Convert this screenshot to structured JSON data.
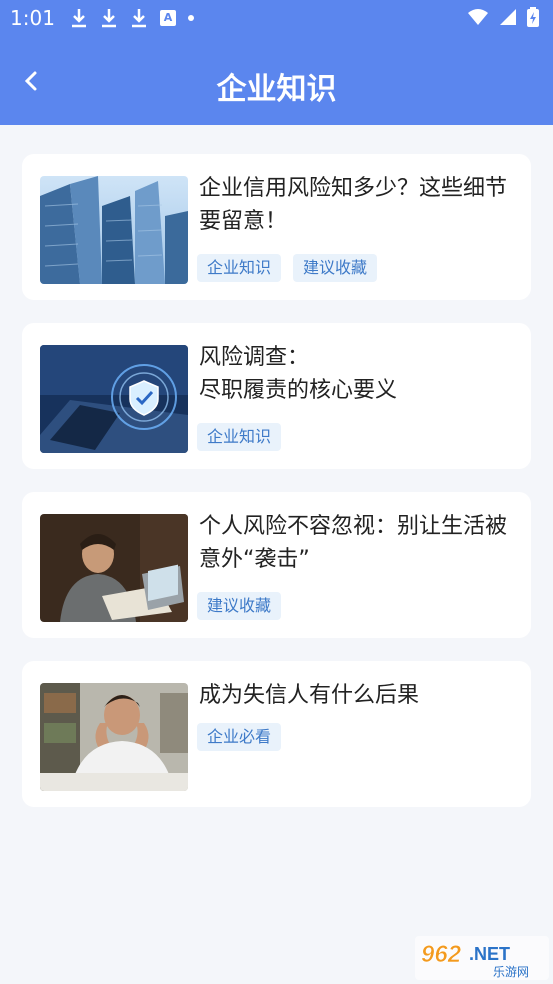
{
  "status_bar": {
    "time": "1:01",
    "icons": [
      "download-icon",
      "download-icon",
      "download-icon",
      "a-badge-icon",
      "dot-icon",
      "wifi-icon",
      "signal-icon",
      "battery-charging-icon"
    ],
    "a_badge": "A"
  },
  "header": {
    "title": "企业知识",
    "back_icon": "chevron-left-icon",
    "background": "#5b86ee"
  },
  "articles": [
    {
      "title": "企业信用风险知多少？这些细节要留意！",
      "image": "skyscraper-photo",
      "tags": [
        "企业知识",
        "建议收藏"
      ]
    },
    {
      "title": "风险调查：\n尽职履责的核心要义",
      "image": "shield-laptop-photo",
      "tags": [
        "企业知识"
      ]
    },
    {
      "title": "个人风险不容忽视：别让生活被意外“袭击”",
      "image": "man-on-phone-photo",
      "tags": [
        "建议收藏"
      ]
    },
    {
      "title": "成为失信人有什么后果",
      "image": "stressed-man-photo",
      "tags": [
        "企业必看"
      ]
    }
  ],
  "watermark": {
    "logo_text": "962.NET",
    "sub_text": "乐游网"
  },
  "colors": {
    "accent": "#5b86ee",
    "tag_bg": "#e9f2fb",
    "tag_text": "#3e7ac8",
    "page_bg": "#f4f6fa"
  }
}
